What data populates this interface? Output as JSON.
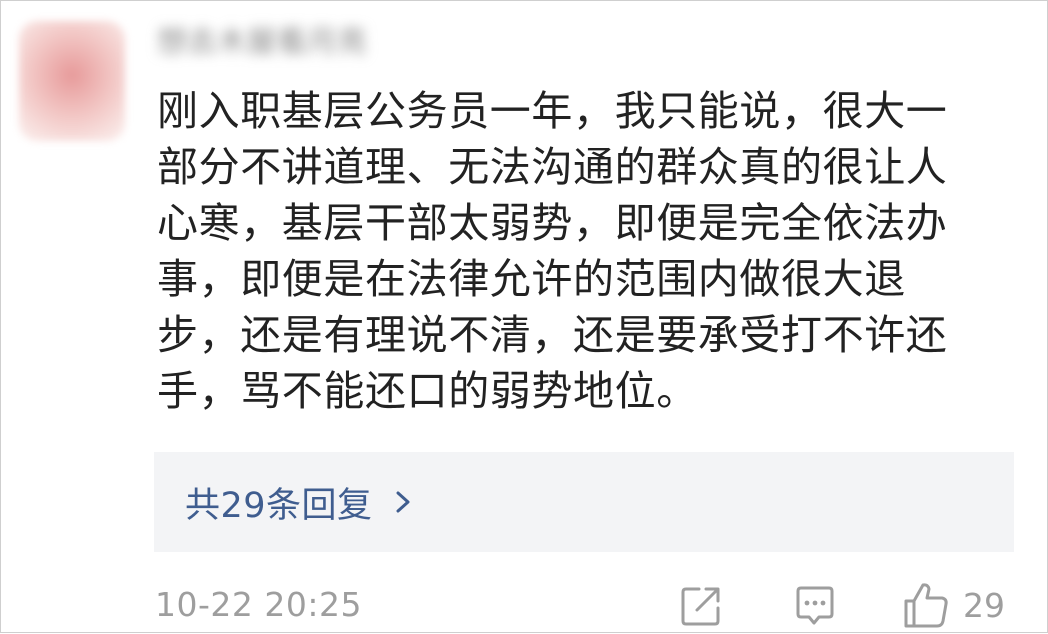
{
  "comment": {
    "username": "想去木屋看月亮",
    "lines": [
      "刚入职基层公务员一年，我只能说，很大一",
      "部分不讲道理、无法沟通的群众真的很让人",
      "心寒，基层干部太弱势，即便是完全依法办",
      "事，即便是在法律允许的范围内做很大退",
      "步，还是有理说不清，还是要承受打不许还",
      "手，骂不能还口的弱势地位。"
    ],
    "replies_label": "共29条回复",
    "timestamp": "10-22 20:25",
    "like_count": "29"
  },
  "icons": {
    "chevron": "chevron-right-icon",
    "share": "share-external-icon",
    "reply": "comment-bubble-icon",
    "like": "thumbs-up-icon"
  },
  "colors": {
    "text": "#222222",
    "link": "#3f5d8f",
    "muted": "#9e9e9e",
    "reply_box_bg": "#f3f4f6"
  }
}
